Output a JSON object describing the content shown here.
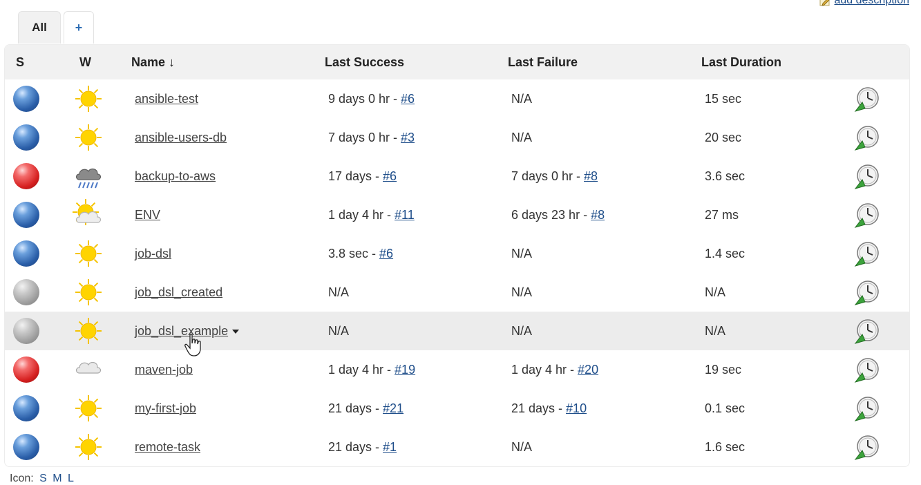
{
  "header": {
    "add_description": "add description"
  },
  "tabs": [
    {
      "label": "All"
    },
    {
      "label": "+"
    }
  ],
  "table": {
    "headers": {
      "status": "S",
      "weather": "W",
      "name": "Name ↓",
      "last_success": "Last Success",
      "last_failure": "Last Failure",
      "last_duration": "Last Duration"
    },
    "rows": [
      {
        "status": "blue",
        "weather": "sunny",
        "name": "ansible-test",
        "success_time": "9 days 0 hr - ",
        "success_build": "#6",
        "failure_time": "N/A",
        "failure_build": "",
        "duration": "15 sec"
      },
      {
        "status": "blue",
        "weather": "sunny",
        "name": "ansible-users-db",
        "success_time": "7 days 0 hr - ",
        "success_build": "#3",
        "failure_time": "N/A",
        "failure_build": "",
        "duration": "20 sec"
      },
      {
        "status": "red",
        "weather": "storm",
        "name": "backup-to-aws",
        "success_time": "17 days - ",
        "success_build": "#6",
        "failure_time": "7 days 0 hr - ",
        "failure_build": "#8",
        "duration": "3.6 sec"
      },
      {
        "status": "blue",
        "weather": "partly-cloudy",
        "name": "ENV",
        "success_time": "1 day 4 hr - ",
        "success_build": "#11",
        "failure_time": "6 days 23 hr - ",
        "failure_build": "#8",
        "duration": "27 ms"
      },
      {
        "status": "blue",
        "weather": "sunny",
        "name": "job-dsl",
        "success_time": "3.8 sec - ",
        "success_build": "#6",
        "failure_time": "N/A",
        "failure_build": "",
        "duration": "1.4 sec"
      },
      {
        "status": "grey",
        "weather": "sunny",
        "name": "job_dsl_created",
        "success_time": "N/A",
        "success_build": "",
        "failure_time": "N/A",
        "failure_build": "",
        "duration": "N/A"
      },
      {
        "status": "grey",
        "weather": "sunny",
        "name": "job_dsl_example",
        "success_time": "N/A",
        "success_build": "",
        "failure_time": "N/A",
        "failure_build": "",
        "duration": "N/A"
      },
      {
        "status": "red",
        "weather": "cloudy",
        "name": "maven-job",
        "success_time": "1 day 4 hr - ",
        "success_build": "#19",
        "failure_time": "1 day 4 hr - ",
        "failure_build": "#20",
        "duration": "19 sec"
      },
      {
        "status": "blue",
        "weather": "sunny",
        "name": "my-first-job",
        "success_time": "21 days - ",
        "success_build": "#21",
        "failure_time": "21 days - ",
        "failure_build": "#10",
        "duration": "0.1 sec"
      },
      {
        "status": "blue",
        "weather": "sunny",
        "name": "remote-task",
        "success_time": "21 days - ",
        "success_build": "#1",
        "failure_time": "N/A",
        "failure_build": "",
        "duration": "1.6 sec"
      }
    ]
  },
  "footer": {
    "icon_label": "Icon:",
    "sizes": [
      "S",
      "M",
      "L"
    ]
  },
  "colors": {
    "link": "#1f4e8a",
    "header_bg": "#f1f1f1",
    "hover_row": "#ececec"
  },
  "icons": {
    "status": "status-ball-icon",
    "weather": "weather-icon",
    "schedule": "schedule-build-icon"
  }
}
